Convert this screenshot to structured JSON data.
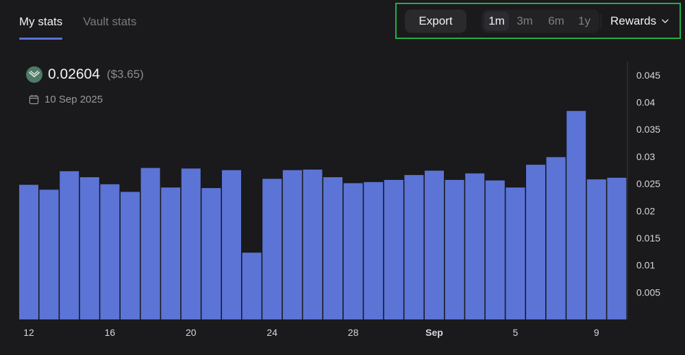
{
  "tabs": [
    {
      "label": "My stats",
      "active": true
    },
    {
      "label": "Vault stats",
      "active": false
    }
  ],
  "controls": {
    "export_label": "Export",
    "ranges": [
      {
        "label": "1m",
        "active": true
      },
      {
        "label": "3m",
        "active": false
      },
      {
        "label": "6m",
        "active": false
      },
      {
        "label": "1y",
        "active": false
      }
    ],
    "metric_label": "Rewards",
    "highlight_color": "#22b04a"
  },
  "summary": {
    "value": "0.02604",
    "usd": "($3.65)",
    "date": "10 Sep 2025",
    "token_icon": "coin-icon"
  },
  "chart_data": {
    "type": "bar",
    "bar_color": "#5b74d6",
    "ylim": [
      0,
      0.0475
    ],
    "yticks": [
      "0.005",
      "0.01",
      "0.015",
      "0.02",
      "0.025",
      "0.03",
      "0.035",
      "0.04",
      "0.045"
    ],
    "xtick_labels": [
      {
        "label": "12",
        "index": 0,
        "bold": false
      },
      {
        "label": "16",
        "index": 4,
        "bold": false
      },
      {
        "label": "20",
        "index": 8,
        "bold": false
      },
      {
        "label": "24",
        "index": 12,
        "bold": false
      },
      {
        "label": "28",
        "index": 16,
        "bold": false
      },
      {
        "label": "Sep",
        "index": 20,
        "bold": true
      },
      {
        "label": "5",
        "index": 24,
        "bold": false
      },
      {
        "label": "9",
        "index": 28,
        "bold": false
      }
    ],
    "values": [
      0.0248,
      0.0239,
      0.0273,
      0.0262,
      0.0249,
      0.0235,
      0.0279,
      0.0243,
      0.0278,
      0.0242,
      0.0275,
      0.0123,
      0.0259,
      0.0275,
      0.0276,
      0.0262,
      0.0251,
      0.0253,
      0.0257,
      0.0266,
      0.0274,
      0.0257,
      0.0269,
      0.0256,
      0.0243,
      0.0285,
      0.0299,
      0.0384,
      0.0258,
      0.0261
    ]
  }
}
